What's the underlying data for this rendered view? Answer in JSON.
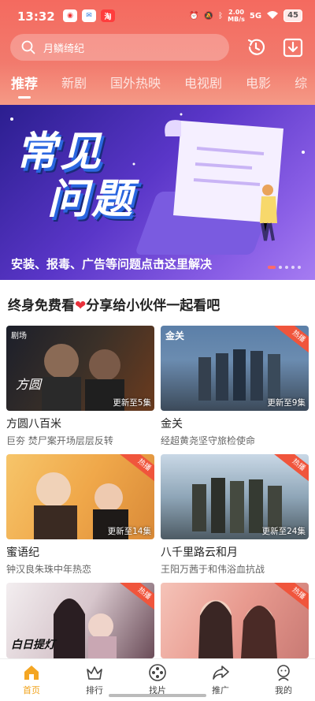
{
  "status_bar": {
    "time": "13:32",
    "network_speed_top": "2.00",
    "network_speed_bottom": "MB/s",
    "signal": "5G",
    "battery": "45"
  },
  "search": {
    "query": "月鳞绮纪"
  },
  "tabs": [
    {
      "label": "推荐",
      "active": true
    },
    {
      "label": "新剧",
      "active": false
    },
    {
      "label": "国外热映",
      "active": false
    },
    {
      "label": "电视剧",
      "active": false
    },
    {
      "label": "电影",
      "active": false
    },
    {
      "label": "综",
      "active": false
    }
  ],
  "banner": {
    "title_line1": "常见",
    "title_line2": "问题",
    "caption": "安装、报毒、广告等问题点击这里解决"
  },
  "section": {
    "title_part1": "终身免费看",
    "title_part2": "分享给小伙伴一起看吧"
  },
  "cards": [
    {
      "name": "方圆八百米",
      "desc": "巨夯 焚尸案开场层层反转",
      "update": "更新至5集",
      "hot": false,
      "badge_brand": "剧场"
    },
    {
      "name": "金关",
      "desc": "经超黄尧坚守旅检使命",
      "update": "更新至9集",
      "hot": true,
      "hot_label": "热播",
      "thumb_title": "金关"
    },
    {
      "name": "蜜语纪",
      "desc": "钟汉良朱珠中年热恋",
      "update": "更新至14集",
      "hot": true,
      "hot_label": "热播"
    },
    {
      "name": "八千里路云和月",
      "desc": "王阳万茜于和伟浴血抗战",
      "update": "更新至24集",
      "hot": true,
      "hot_label": "热播"
    },
    {
      "name": "",
      "desc": "",
      "update": "",
      "hot": true,
      "hot_label": "热播",
      "thumb_title": "白日提灯"
    },
    {
      "name": "",
      "desc": "",
      "update": "",
      "hot": true,
      "hot_label": "热播"
    }
  ],
  "bottom_nav": [
    {
      "label": "首页",
      "icon": "home-icon",
      "active": true
    },
    {
      "label": "排行",
      "icon": "crown-icon",
      "active": false
    },
    {
      "label": "找片",
      "icon": "film-reel-icon",
      "active": false
    },
    {
      "label": "推广",
      "icon": "share-arrow-icon",
      "active": false
    },
    {
      "label": "我的",
      "icon": "user-icon",
      "active": false
    }
  ],
  "colors": {
    "header_start": "#f46a5f",
    "header_end": "#f59a86",
    "active_nav": "#f1a21a",
    "hot_badge": "#f0553c",
    "banner_purple": "#5a36c8"
  }
}
